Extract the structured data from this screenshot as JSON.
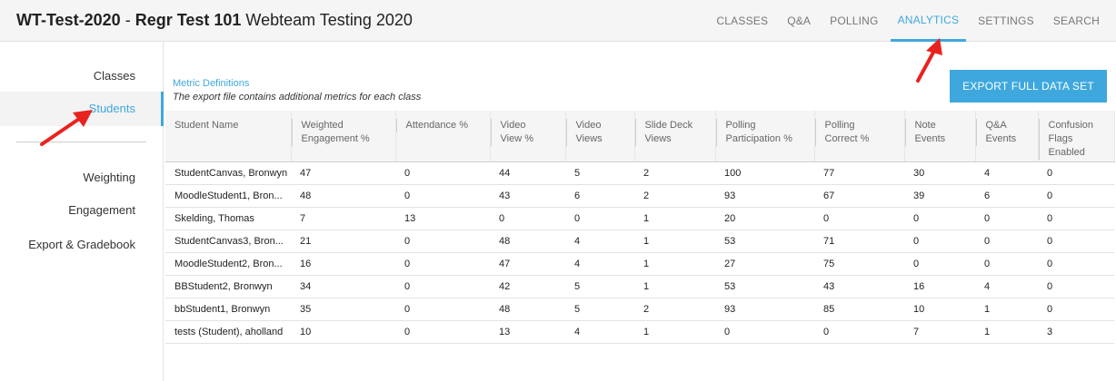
{
  "header": {
    "course_code": "WT-Test-2020",
    "separator": " - ",
    "course_name": "Regr Test 101",
    "course_desc": " Webteam Testing 2020"
  },
  "top_nav": [
    {
      "label": "CLASSES",
      "active": false
    },
    {
      "label": "Q&A",
      "active": false
    },
    {
      "label": "POLLING",
      "active": false
    },
    {
      "label": "ANALYTICS",
      "active": true
    },
    {
      "label": "SETTINGS",
      "active": false
    },
    {
      "label": "SEARCH",
      "active": false
    }
  ],
  "sidebar": {
    "items": [
      {
        "label": "Classes"
      },
      {
        "label": "Students"
      },
      {
        "label": "Weighting"
      },
      {
        "label": "Engagement"
      },
      {
        "label": "Export & Gradebook"
      }
    ]
  },
  "main": {
    "metric_link": "Metric Definitions",
    "export_note": "The export file contains additional metrics for each class",
    "export_button": "EXPORT FULL DATA SET"
  },
  "table": {
    "headers": [
      [
        "Student Name"
      ],
      [
        "Weighted",
        "Engagement %"
      ],
      [
        "Attendance %"
      ],
      [
        "Video",
        "View %"
      ],
      [
        "Video",
        "Views"
      ],
      [
        "Slide Deck",
        "Views"
      ],
      [
        "Polling",
        "Participation %"
      ],
      [
        "Polling",
        "Correct %"
      ],
      [
        "Note",
        "Events"
      ],
      [
        "Q&A",
        "Events"
      ],
      [
        "Confusion",
        "Flags",
        "Enabled"
      ]
    ],
    "rows": [
      [
        "StudentCanvas, Bronwyn",
        "47",
        "0",
        "44",
        "5",
        "2",
        "100",
        "77",
        "30",
        "4",
        "0"
      ],
      [
        "MoodleStudent1, Bron...",
        "48",
        "0",
        "43",
        "6",
        "2",
        "93",
        "67",
        "39",
        "6",
        "0"
      ],
      [
        "Skelding, Thomas",
        "7",
        "13",
        "0",
        "0",
        "1",
        "20",
        "0",
        "0",
        "0",
        "0"
      ],
      [
        "StudentCanvas3, Bron...",
        "21",
        "0",
        "48",
        "4",
        "1",
        "53",
        "71",
        "0",
        "0",
        "0"
      ],
      [
        "MoodleStudent2, Bron...",
        "16",
        "0",
        "47",
        "4",
        "1",
        "27",
        "75",
        "0",
        "0",
        "0"
      ],
      [
        "BBStudent2, Bronwyn",
        "34",
        "0",
        "42",
        "5",
        "1",
        "53",
        "43",
        "16",
        "4",
        "0"
      ],
      [
        "bbStudent1, Bronwyn",
        "35",
        "0",
        "48",
        "5",
        "2",
        "93",
        "85",
        "10",
        "1",
        "0"
      ],
      [
        "tests (Student), aholland",
        "10",
        "0",
        "13",
        "4",
        "1",
        "0",
        "0",
        "7",
        "1",
        "3"
      ]
    ]
  },
  "colors": {
    "accent": "#3ea8de",
    "annotation_arrow": "#e8231f"
  }
}
